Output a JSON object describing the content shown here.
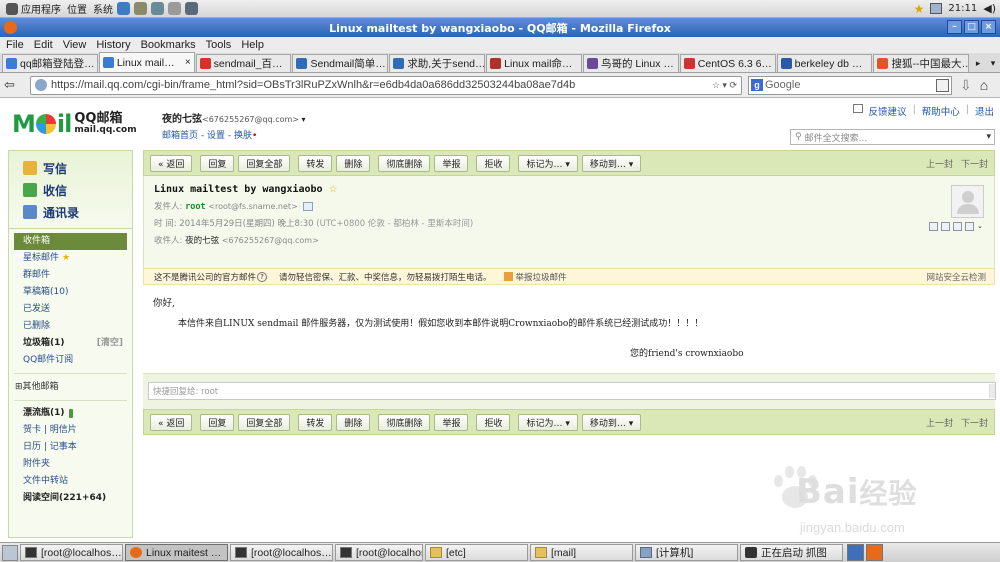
{
  "system_panel": {
    "menus": [
      "应用程序",
      "位置",
      "系统"
    ],
    "clock": "21:11"
  },
  "window": {
    "title": "Linux mailtest by wangxiaobo - QQ邮箱 - Mozilla Firefox"
  },
  "menubar": [
    "File",
    "Edit",
    "View",
    "History",
    "Bookmarks",
    "Tools",
    "Help"
  ],
  "tabs": [
    {
      "label": "qq邮箱登陆登…",
      "color": "#3a7bd5",
      "active": false
    },
    {
      "label": "Linux mail…",
      "color": "#3a7bd5",
      "active": true
    },
    {
      "label": "sendmail_百…",
      "color": "#d9312a",
      "active": false
    },
    {
      "label": "Sendmail简单…",
      "color": "#2e6db5",
      "active": false
    },
    {
      "label": "求助,关于send…",
      "color": "#2e6db5",
      "active": false
    },
    {
      "label": "Linux mail命…",
      "color": "#b0312a",
      "active": false
    },
    {
      "label": "鸟哥的 Linux …",
      "color": "#6a4a9a",
      "active": false
    },
    {
      "label": "CentOS 6.3 6…",
      "color": "#cc3333",
      "active": false
    },
    {
      "label": "berkeley db …",
      "color": "#2a5aa5",
      "active": false
    },
    {
      "label": "搜狐--中国最大…",
      "color": "#e0562a",
      "active": false
    }
  ],
  "navbar": {
    "url": "https://mail.qq.com/cgi-bin/frame_html?sid=OBsTr3lRuPZxWnlh&r=e6db4da0a686dd32503244ba08ae7d4b",
    "search_placeholder": "Google"
  },
  "qq": {
    "brand_cn": "QQ邮箱",
    "brand_en": "mail.qq.com",
    "nickname": "夜的七弦",
    "address": "<676255267@qq.com>",
    "links": [
      "邮箱首页",
      "设置",
      "换肤"
    ],
    "top_links": [
      "反馈建议",
      "帮助中心",
      "退出"
    ],
    "search_placeholder": "邮件全文搜索..."
  },
  "sidebar": {
    "actions": [
      "写信",
      "收信",
      "通讯录"
    ],
    "folders": [
      {
        "label": "收件箱",
        "extra": "",
        "selected": true,
        "bold": false,
        "star": false
      },
      {
        "label": "星标邮件",
        "extra": "",
        "selected": false,
        "bold": false,
        "star": true
      },
      {
        "label": "群邮件",
        "extra": "",
        "selected": false,
        "bold": false,
        "star": false
      },
      {
        "label": "草稿箱(10)",
        "extra": "",
        "selected": false,
        "bold": false,
        "star": false
      },
      {
        "label": "已发送",
        "extra": "",
        "selected": false,
        "bold": false,
        "star": false
      },
      {
        "label": "已删除",
        "extra": "",
        "selected": false,
        "bold": false,
        "star": false
      },
      {
        "label": "垃圾箱(1)",
        "extra": "[清空]",
        "selected": false,
        "bold": true,
        "star": false
      },
      {
        "label": "QQ邮件订阅",
        "extra": "",
        "selected": false,
        "bold": false,
        "star": false
      }
    ],
    "other_group": "其他邮箱",
    "extras": [
      {
        "label": "漂流瓶(1)",
        "bold": true
      },
      {
        "label": "贺卡 | 明信片",
        "bold": false
      },
      {
        "label": "日历 | 记事本",
        "bold": false
      },
      {
        "label": "附件夹",
        "bold": false
      },
      {
        "label": "文件中转站",
        "bold": false
      },
      {
        "label": "阅读空间(221+64)",
        "bold": true
      }
    ]
  },
  "toolbar": {
    "buttons": [
      "« 返回",
      "回复",
      "回复全部",
      "转发",
      "删除",
      "彻底删除",
      "举报",
      "拒收",
      "标记为… ▾",
      "移动到… ▾"
    ],
    "prev": "上一封",
    "next": "下一封"
  },
  "mail": {
    "subject": "Linux mailtest by wangxiaobo",
    "from_label": "发件人:",
    "from_name": "root",
    "from_addr": "<root@fs.sname.net>",
    "time_label": "时  间:",
    "time_value": "2014年5月29日(星期四) 晚上8:30",
    "time_zone": "(UTC+0800 伦敦 - 都柏林 - 里斯本时间)",
    "to_label": "收件人:",
    "to_name": "夜的七弦",
    "to_addr": "<676255267@qq.com>",
    "notice": "这不是腾讯公司的官方邮件",
    "notice_q": "?",
    "notice_warn": "请勿轻信密保、汇款、中奖信息，勿轻易拨打陌生电话。",
    "report_spam": "举报垃圾邮件",
    "security": "网站安全云检测",
    "body_greeting": "你好,",
    "body_text": "本信件来自LINUX sendmail 邮件服务器，仅为测试使用！假如您收到本邮件说明Crownxiaobo的邮件系统已经测试成功！！！！",
    "signature": "您的friend's crownxiaobo",
    "quick_reply": "快捷回复给: root"
  },
  "watermark": {
    "text": "Bai",
    "text_cn": "经验",
    "url": "jingyan.baidu.com"
  },
  "taskbar": [
    {
      "label": "[root@localhos…",
      "icon": "term",
      "active": false,
      "w": 103
    },
    {
      "label": "Linux maitest …",
      "icon": "ff",
      "active": true,
      "w": 103
    },
    {
      "label": "[root@localhos…",
      "icon": "term",
      "active": false,
      "w": 103
    },
    {
      "label": "[root@localhos…",
      "icon": "term",
      "active": false,
      "w": 88
    },
    {
      "label": "[etc]",
      "icon": "fold",
      "active": false,
      "w": 103
    },
    {
      "label": "[mail]",
      "icon": "fold",
      "active": false,
      "w": 103
    },
    {
      "label": "[计算机]",
      "icon": "comp",
      "active": false,
      "w": 103
    },
    {
      "label": "正在启动 抓图",
      "icon": "cam",
      "active": false,
      "w": 103
    }
  ]
}
